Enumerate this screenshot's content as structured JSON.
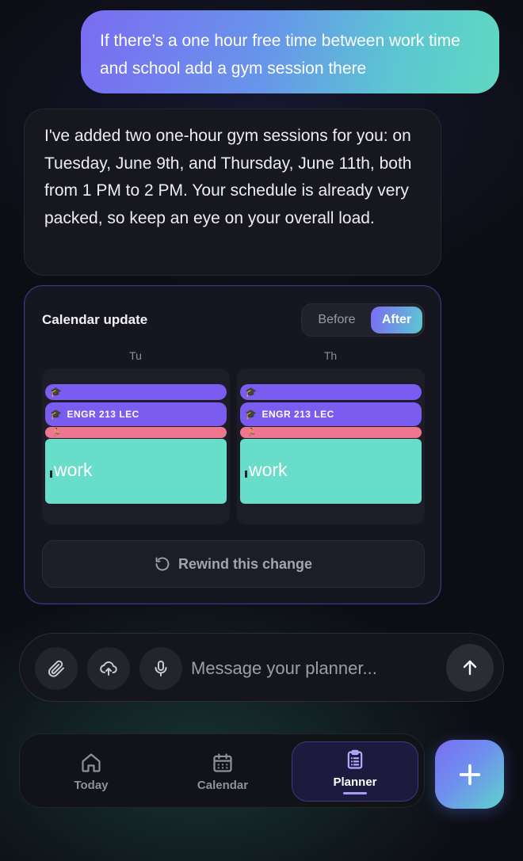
{
  "chat": {
    "user_message": "If there’s a one hour free time between work time and school add a gym session there",
    "assistant_message": "I've added two one-hour gym sessions for you: on Tuesday, June 9th, and Thursday, June 11th, both from 1 PM to 2 PM. Your schedule is already very packed, so keep an eye on your overall load."
  },
  "calendar_update": {
    "title": "Calendar update",
    "toggle": {
      "before_label": "Before",
      "after_label": "After",
      "selected": "After"
    },
    "days": [
      {
        "label": "Tu",
        "events": [
          {
            "type": "class",
            "label": "",
            "icon": "graduation-cap-icon"
          },
          {
            "type": "class",
            "label": "ENGR 213 LEC",
            "icon": "graduation-cap-icon"
          },
          {
            "type": "gym",
            "label": "",
            "icon": "runner-icon"
          },
          {
            "type": "work",
            "label": "work"
          }
        ]
      },
      {
        "label": "Th",
        "events": [
          {
            "type": "class",
            "label": "",
            "icon": "graduation-cap-icon"
          },
          {
            "type": "class",
            "label": "ENGR 213 LEC",
            "icon": "graduation-cap-icon"
          },
          {
            "type": "gym",
            "label": "",
            "icon": "runner-icon"
          },
          {
            "type": "work",
            "label": "work"
          }
        ]
      }
    ],
    "rewind_label": "Rewind this change"
  },
  "composer": {
    "placeholder": "Message your planner...",
    "icons": [
      "paperclip-icon",
      "cloud-upload-icon",
      "microphone-icon",
      "arrow-up-icon"
    ]
  },
  "nav": {
    "items": [
      {
        "label": "Today",
        "icon": "home-icon"
      },
      {
        "label": "Calendar",
        "icon": "calendar-icon"
      },
      {
        "label": "Planner",
        "icon": "clipboard-icon"
      }
    ],
    "active": "Planner"
  },
  "colors": {
    "accent_purple": "#7b5cf0",
    "accent_teal": "#68ddc9",
    "gym_pink": "#f0758f",
    "background": "#0d0e15"
  }
}
